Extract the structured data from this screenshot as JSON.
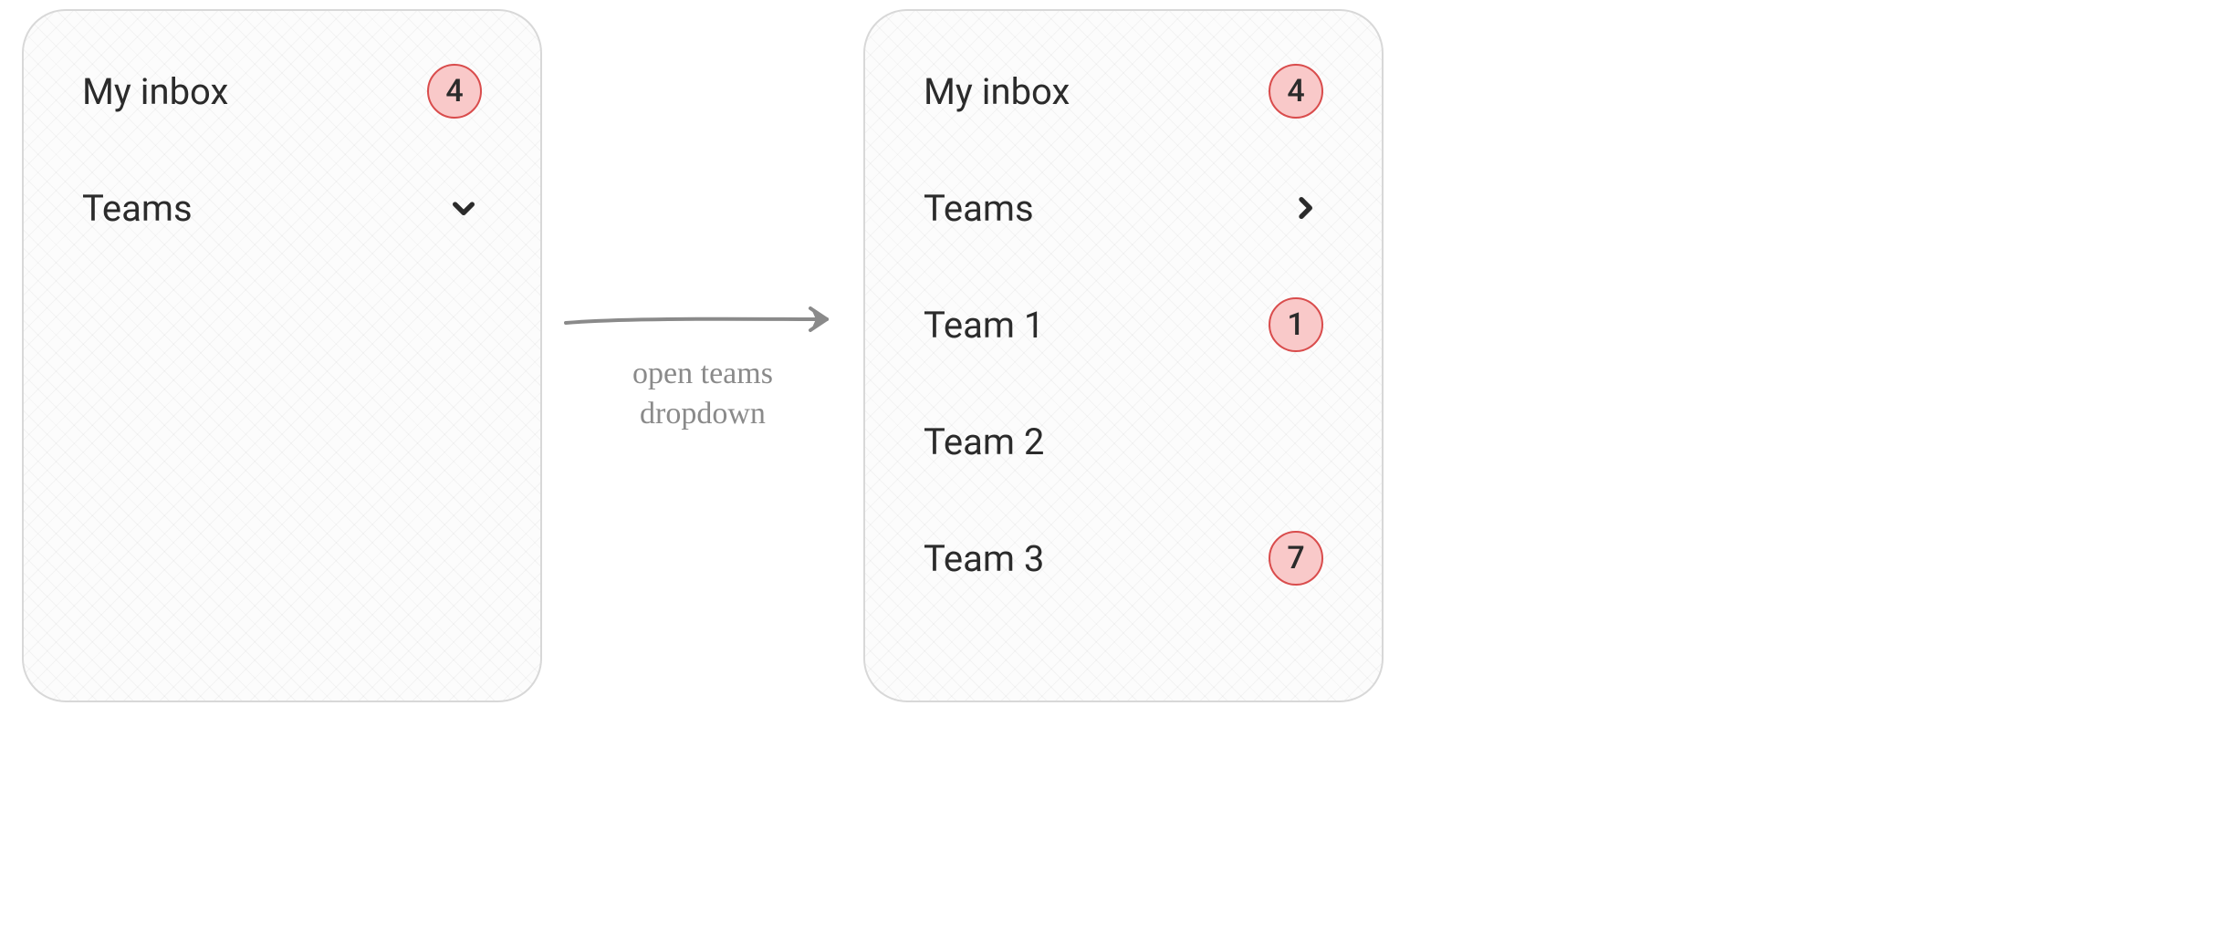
{
  "left_panel": {
    "inbox": {
      "label": "My inbox",
      "badge": "4"
    },
    "teams": {
      "label": "Teams",
      "expanded": false
    }
  },
  "right_panel": {
    "inbox": {
      "label": "My inbox",
      "badge": "4"
    },
    "teams": {
      "label": "Teams",
      "expanded": true
    },
    "team_items": [
      {
        "label": "Team 1",
        "badge": "1"
      },
      {
        "label": "Team 2",
        "badge": null
      },
      {
        "label": "Team 3",
        "badge": "7"
      }
    ]
  },
  "transition": {
    "caption": "open teams\ndropdown"
  }
}
